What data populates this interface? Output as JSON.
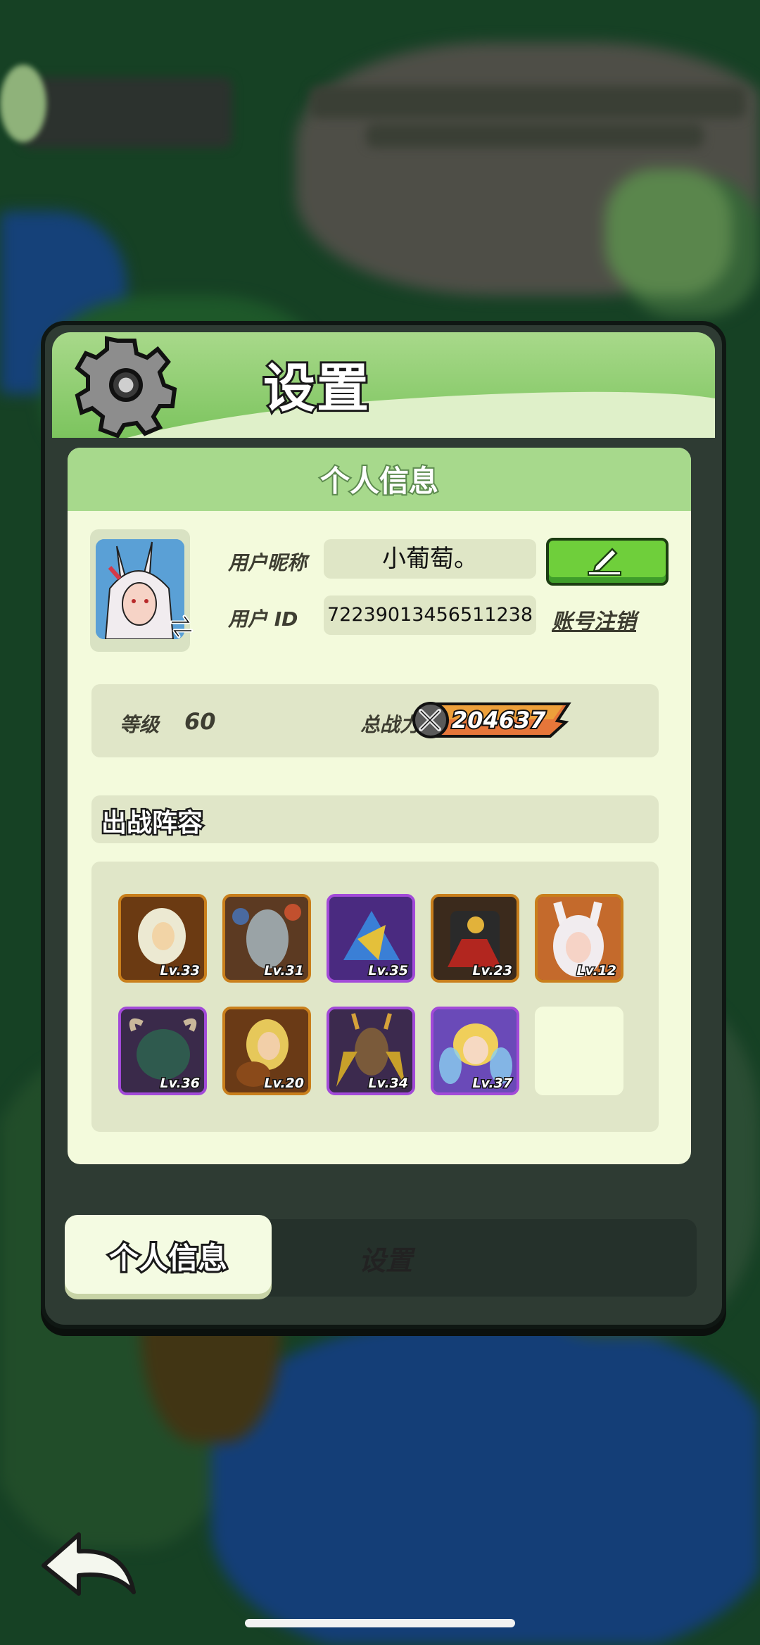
{
  "dialog": {
    "title": "设置"
  },
  "profile": {
    "section_title": "个人信息",
    "nickname_label": "用户昵称",
    "nickname_value": "小葡萄。",
    "id_label": "用户 ID",
    "id_value": "7223901345651123​8",
    "account_logout": "账号注销",
    "level_label": "等级",
    "level_value": "60",
    "power_label": "总战力",
    "power_value": "204637"
  },
  "lineup": {
    "title": "出战阵容",
    "heroes": [
      {
        "level": "Lv.33",
        "rarity": "orange"
      },
      {
        "level": "Lv.31",
        "rarity": "orange"
      },
      {
        "level": "Lv.35",
        "rarity": "purple"
      },
      {
        "level": "Lv.23",
        "rarity": "orange"
      },
      {
        "level": "Lv.12",
        "rarity": "orange"
      },
      {
        "level": "Lv.36",
        "rarity": "purple"
      },
      {
        "level": "Lv.20",
        "rarity": "orange"
      },
      {
        "level": "Lv.34",
        "rarity": "purple"
      },
      {
        "level": "Lv.37",
        "rarity": "purple"
      }
    ]
  },
  "tabs": {
    "active": "个人信息",
    "inactive": "设置"
  },
  "colors": {
    "accent_green": "#7cc45e",
    "panel_dark": "#2e3b33",
    "card_bg": "#f3fadc"
  },
  "icons": [
    "gear-icon",
    "edit-pencil-icon",
    "swap-arrow-icon",
    "crossed-swords-icon",
    "back-arrow-icon"
  ]
}
